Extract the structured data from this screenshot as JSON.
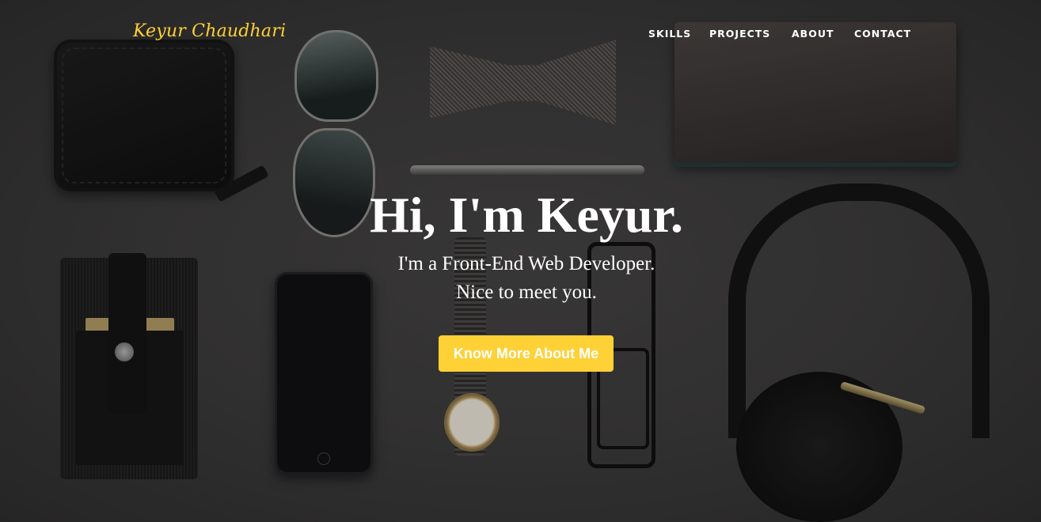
{
  "brand": {
    "name": "Keyur Chaudhari"
  },
  "nav": {
    "items": [
      "SKILLS",
      "PROJECTS",
      "ABOUT",
      "CONTACT"
    ]
  },
  "hero": {
    "title": "Hi, I'm Keyur.",
    "subtitle_line1": "I'm a Front-End Web Developer.",
    "subtitle_line2": "Nice to meet you.",
    "cta_label": "Know More About Me"
  },
  "colors": {
    "accent": "#fed136",
    "text": "#ffffff",
    "background": "#3a3939"
  }
}
